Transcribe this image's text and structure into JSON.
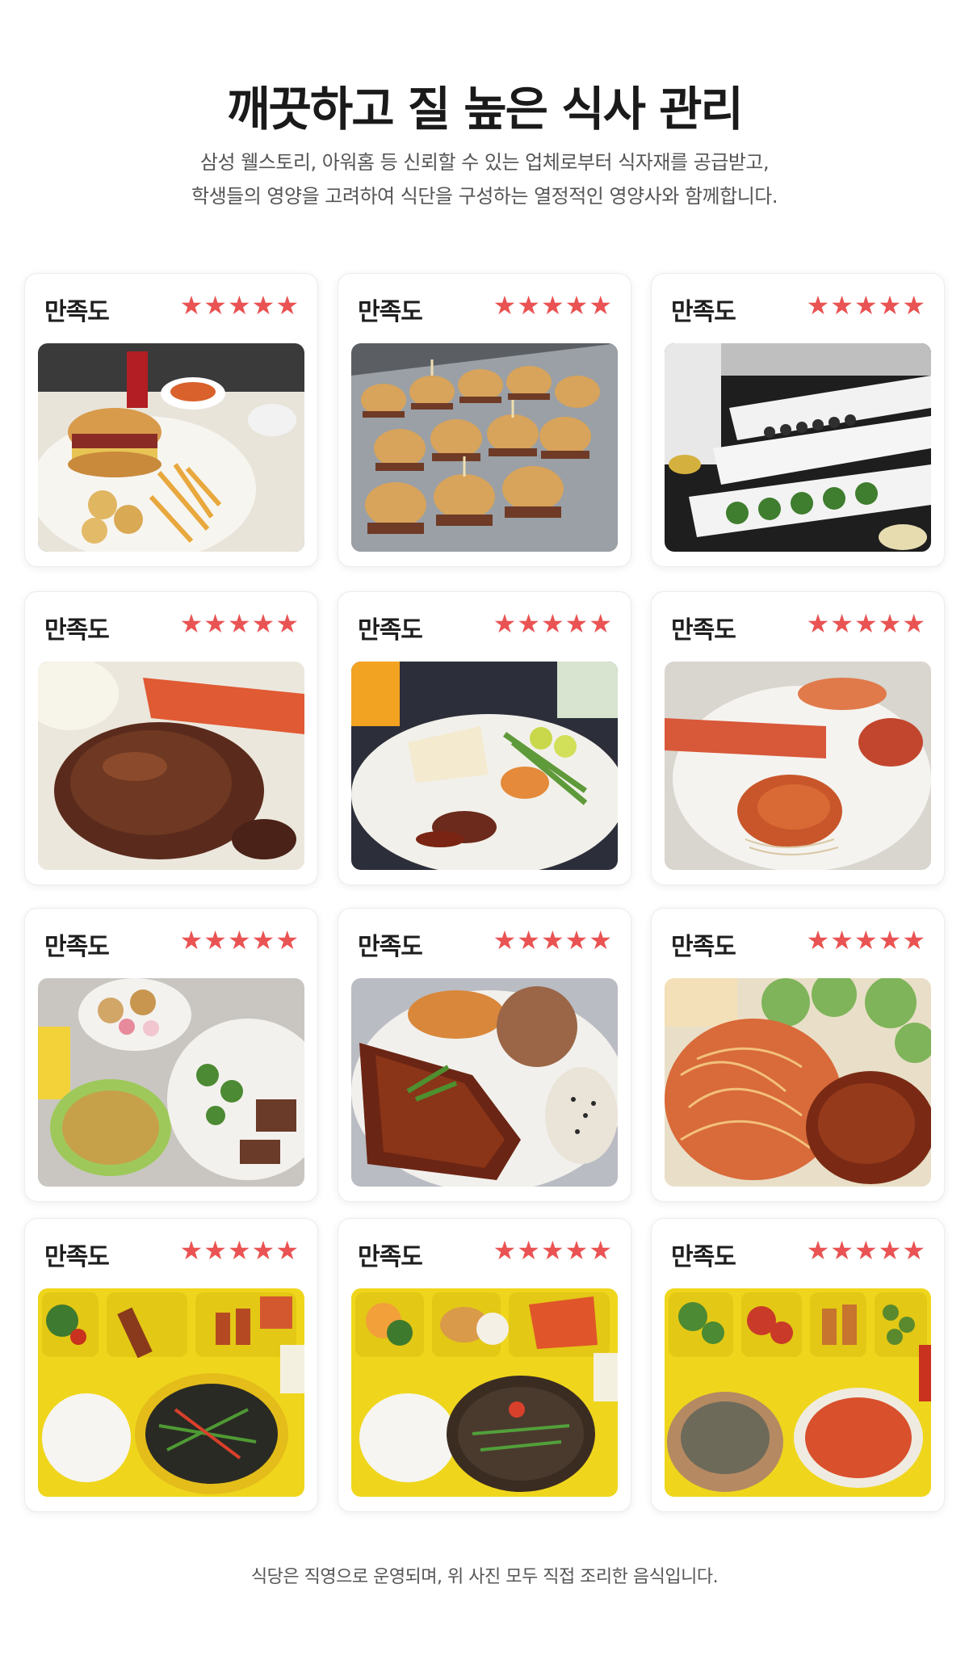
{
  "header": {
    "title": "깨끗하고 질 높은 식사 관리",
    "subtitle_line1": "삼성 웰스토리, 아워홈 등 신뢰할 수 있는 업체로부터 식자재를 공급받고,",
    "subtitle_line2": "학생들의 영양을 고려하여 식단을 구성하는 열정적인 영양사와 함께합니다."
  },
  "cards": [
    {
      "label": "만족도",
      "stars": "★★★★★",
      "rating": 5,
      "photo": "burger-fries-plate"
    },
    {
      "label": "만족도",
      "stars": "★★★★★",
      "rating": 5,
      "photo": "mini-burgers-tray"
    },
    {
      "label": "만족도",
      "stars": "★★★★★",
      "rating": 5,
      "photo": "buffet-line"
    },
    {
      "label": "만족도",
      "stars": "★★★★★",
      "rating": 5,
      "photo": "steak-lobster"
    },
    {
      "label": "만족도",
      "stars": "★★★★★",
      "rating": 5,
      "photo": "steak-shrimp-plate"
    },
    {
      "label": "만족도",
      "stars": "★★★★★",
      "rating": 5,
      "photo": "lobster-pasta"
    },
    {
      "label": "만족도",
      "stars": "★★★★★",
      "rating": 5,
      "photo": "soup-salad-dessert"
    },
    {
      "label": "만족도",
      "stars": "★★★★★",
      "rating": 5,
      "photo": "bbq-ribs-plate"
    },
    {
      "label": "만족도",
      "stars": "★★★★★",
      "rating": 5,
      "photo": "pasta-steak"
    },
    {
      "label": "만족도",
      "stars": "★★★★★",
      "rating": 5,
      "photo": "school-tray-noodles"
    },
    {
      "label": "만족도",
      "stars": "★★★★★",
      "rating": 5,
      "photo": "school-tray-bungeoppang"
    },
    {
      "label": "만족도",
      "stars": "★★★★★",
      "rating": 5,
      "photo": "school-tray-bread-bowl"
    }
  ],
  "footer": {
    "note": "식당은 직영으로 운영되며, 위 사진 모두 직접 조리한 음식입니다."
  },
  "colors": {
    "star": "#ea5353",
    "title": "#1a1a1a",
    "subtitle": "#555555",
    "tray_yellow": "#f2d821"
  }
}
